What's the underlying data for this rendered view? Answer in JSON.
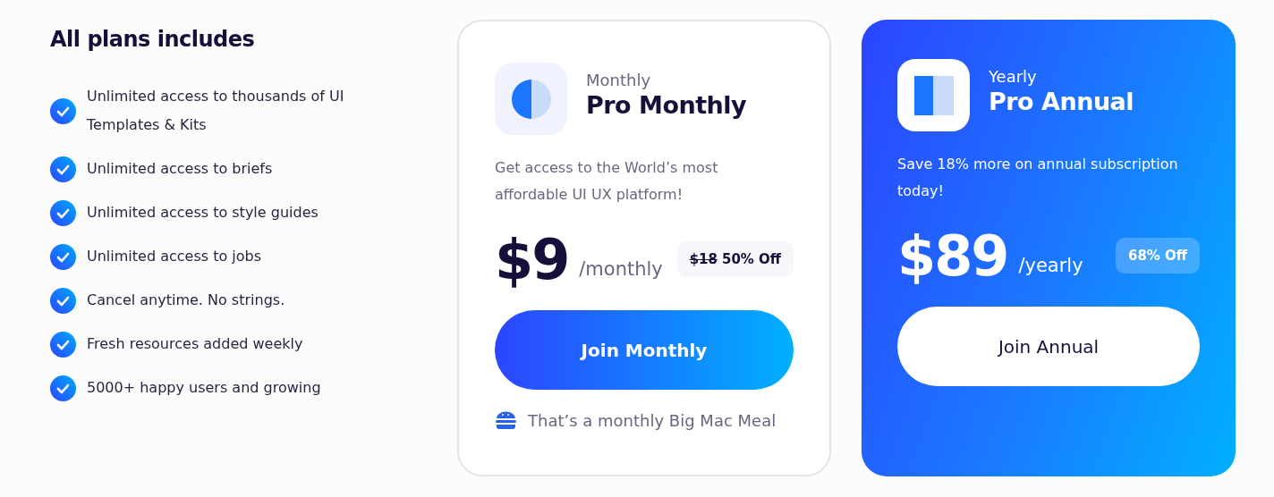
{
  "features": {
    "title": "All plans includes",
    "items": [
      {
        "text": "Unlimited access to thousands of UI Templates & Kits"
      },
      {
        "text": "Unlimited access to briefs"
      },
      {
        "text": "Unlimited access to style guides"
      },
      {
        "text": "Unlimited access to jobs"
      },
      {
        "text": "Cancel anytime. No strings."
      },
      {
        "text": "Fresh resources added weekly"
      },
      {
        "text": "5000+ happy users and growing"
      }
    ]
  },
  "plans": [
    {
      "kind": "outline",
      "period": "Monthly",
      "name": "Pro Monthly",
      "description": "Get access to the World’s most affordable UI UX platform!",
      "price": "$9",
      "unit": "/monthly",
      "old_price": "$18",
      "discount": "50% Off",
      "button": "Join Monthly",
      "note": "That’s a monthly Big Mac Meal"
    },
    {
      "kind": "filled",
      "period": "Yearly",
      "name": "Pro Annual",
      "description": "Save 18% more on annual subscription today!",
      "price": "$89",
      "unit": "/yearly",
      "discount": "68% Off",
      "button": "Join Annual"
    }
  ]
}
